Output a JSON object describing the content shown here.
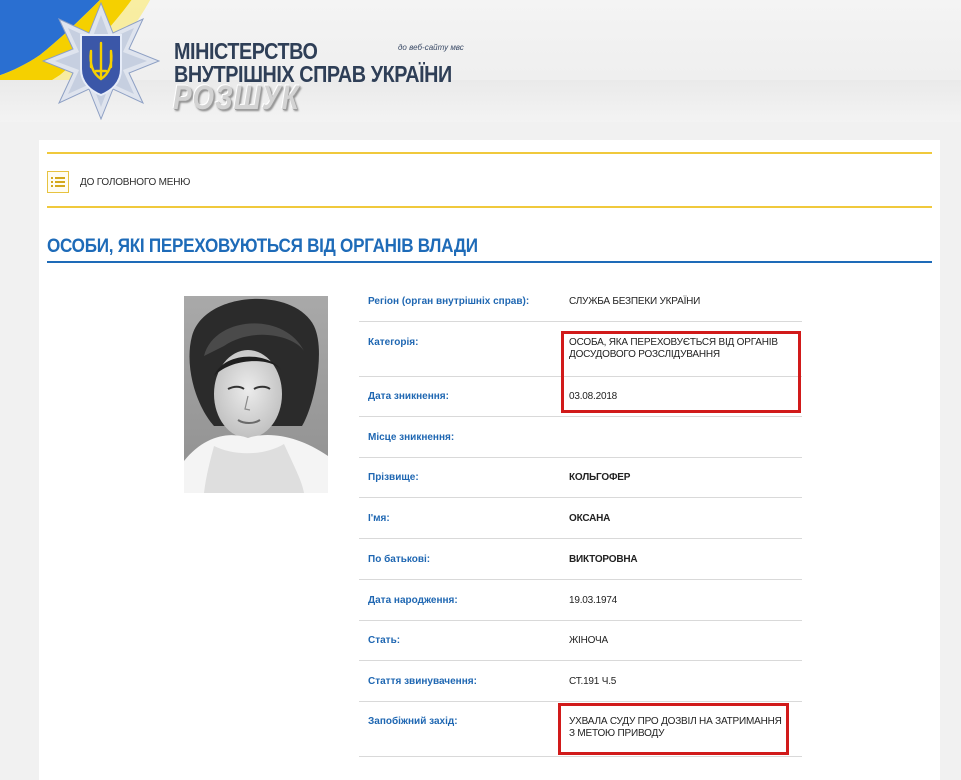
{
  "header": {
    "ministry_line1": "МІНІСТЕРСТВО",
    "ministry_line2": "ВНУТРІШНІХ СПРАВ УКРАЇНИ",
    "site_link": "до веб-сайту мвс",
    "section_word": "РОЗШУК",
    "colors": {
      "flag_blue": "#2a6fd1",
      "flag_yellow": "#f5d000",
      "emblem_blue": "#3b57a8"
    }
  },
  "nav": {
    "menu_icon": "list-icon",
    "menu_link": "ДО ГОЛОВНОГО МЕНЮ"
  },
  "page": {
    "title": "ОСОБИ, ЯКІ ПЕРЕХОВУЮТЬСЯ ВІД ОРГАНІВ ВЛАДИ"
  },
  "person": {
    "rows": [
      {
        "label": "Регіон (орган внутрішніх справ):",
        "value": "СЛУЖБА БЕЗПЕКИ УКРАЇНИ",
        "bold": false
      },
      {
        "label": "Категорія:",
        "value": "ОСОБА, ЯКА ПЕРЕХОВУЄТЬСЯ ВІД ОРГАНІВ ДОСУДОВОГО РОЗСЛІДУВАННЯ",
        "bold": false
      },
      {
        "label": "Дата зникнення:",
        "value": "03.08.2018",
        "bold": false
      },
      {
        "label": "Місце зникнення:",
        "value": "",
        "bold": false
      },
      {
        "label": "Прізвище:",
        "value": "КОЛЬГОФЕР",
        "bold": true
      },
      {
        "label": "І'мя:",
        "value": "ОКСАНА",
        "bold": true
      },
      {
        "label": "По батькові:",
        "value": "ВИКТОРОВНА",
        "bold": true
      },
      {
        "label": "Дата народження:",
        "value": "19.03.1974",
        "bold": false
      },
      {
        "label": "Стать:",
        "value": "ЖІНОЧА",
        "bold": false
      },
      {
        "label": "Стаття звинувачення:",
        "value": "СТ.191 Ч.5",
        "bold": false
      },
      {
        "label": "Запобіжний захід:",
        "value": "УХВАЛА СУДУ ПРО ДОЗВІЛ НА ЗАТРИМАННЯ З МЕТОЮ ПРИВОДУ",
        "bold": false
      }
    ]
  },
  "annotation_color": "#d11a1a"
}
